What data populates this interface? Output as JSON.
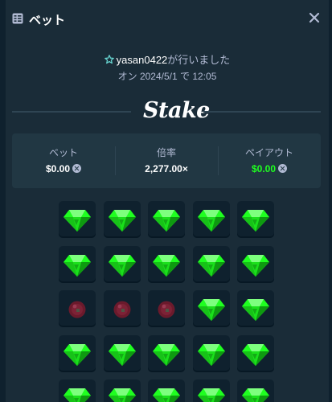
{
  "header": {
    "title": "ベット",
    "icon": "bet-slip-icon"
  },
  "bet_info": {
    "username": "yasan0422",
    "action": "が行いました",
    "date_text": "オン 2024/5/1 で 12:05"
  },
  "brand": {
    "logo_text": "Stake"
  },
  "stats": {
    "bet_label": "ベット",
    "bet_value": "$0.00",
    "multiplier_label": "倍率",
    "multiplier_value": "2,277.00×",
    "payout_label": "ペイアウト",
    "payout_value": "$0.00",
    "currency_icon": "coin-icon"
  },
  "colors": {
    "background": "#1a2c38",
    "panel": "#213743",
    "tile": "#0f212e",
    "gem": "#1fff20",
    "mine": "#6b1a2c",
    "payout_green": "#1fff20"
  },
  "tiles": [
    "gem",
    "gem",
    "gem",
    "gem",
    "gem",
    "gem",
    "gem",
    "gem",
    "gem",
    "gem",
    "mine",
    "mine",
    "mine",
    "gem",
    "gem",
    "gem",
    "gem",
    "gem",
    "gem",
    "gem",
    "gem",
    "gem",
    "gem",
    "gem",
    "gem"
  ]
}
